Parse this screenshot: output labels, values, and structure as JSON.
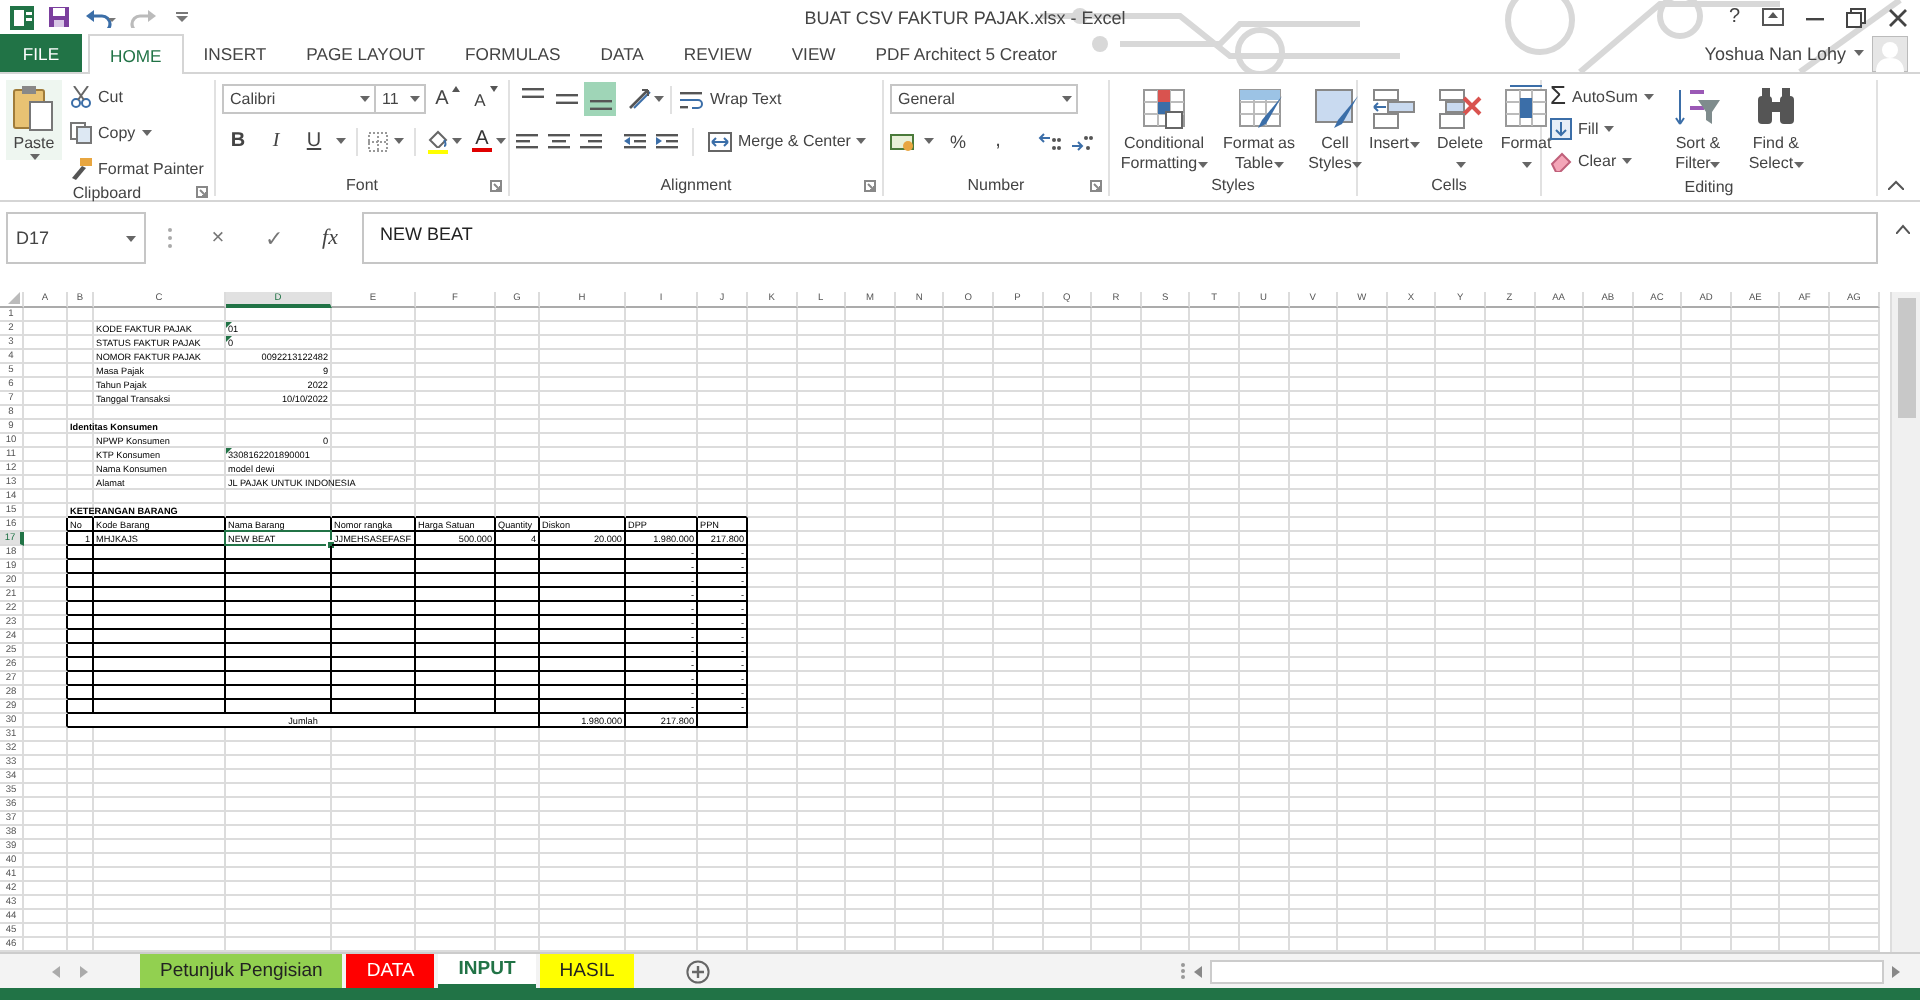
{
  "title_bar": {
    "title": "BUAT CSV FAKTUR PAJAK.xlsx - Excel",
    "help": "?"
  },
  "ribbon_tabs": [
    {
      "label": "FILE",
      "kind": "file",
      "selected": false
    },
    {
      "label": "HOME",
      "kind": "tab",
      "selected": true
    },
    {
      "label": "INSERT",
      "kind": "tab",
      "selected": false
    },
    {
      "label": "PAGE LAYOUT",
      "kind": "tab",
      "selected": false
    },
    {
      "label": "FORMULAS",
      "kind": "tab",
      "selected": false
    },
    {
      "label": "DATA",
      "kind": "tab",
      "selected": false
    },
    {
      "label": "REVIEW",
      "kind": "tab",
      "selected": false
    },
    {
      "label": "VIEW",
      "kind": "tab",
      "selected": false
    },
    {
      "label": "PDF Architect 5 Creator",
      "kind": "tab",
      "selected": false
    }
  ],
  "user": {
    "name": "Yoshua Nan Lohy"
  },
  "clipboard": {
    "paste": "Paste",
    "cut": "Cut",
    "copy": "Copy",
    "format_painter": "Format Painter",
    "label": "Clipboard"
  },
  "font": {
    "name": "Calibri",
    "size": "11",
    "grow": "A",
    "shrink": "A",
    "bold": "B",
    "italic": "I",
    "underline": "U",
    "color_button": "A",
    "label": "Font"
  },
  "alignment": {
    "vertical": [
      {
        "kind": "top",
        "selected": false
      },
      {
        "kind": "middle",
        "selected": false
      },
      {
        "kind": "bottom",
        "selected": true
      }
    ],
    "wrap_text": "Wrap Text",
    "merge": "Merge & Center",
    "label": "Alignment"
  },
  "number": {
    "format": "General",
    "percent": "%",
    "comma": ",",
    "label": "Number"
  },
  "styles": {
    "buttons": [
      "Conditional Formatting",
      "Format as Table",
      "Cell Styles"
    ],
    "label": "Styles"
  },
  "cells": {
    "buttons": [
      "Insert",
      "Delete",
      "Format"
    ],
    "label": "Cells"
  },
  "editing": {
    "sigma": "Σ",
    "autosum": "AutoSum",
    "fill": "Fill",
    "clear": "Clear",
    "sort": "Sort & Filter",
    "find": "Find & Select",
    "label": "Editing"
  },
  "formula_bar": {
    "name_box": "D17",
    "cancel": "×",
    "enter": "✓",
    "function": "fx",
    "value": "NEW BEAT"
  },
  "sheet": {
    "columns": [
      "A",
      "B",
      "C",
      "D",
      "E",
      "F",
      "G",
      "H",
      "I",
      "J",
      "K",
      "L",
      "M",
      "N",
      "O",
      "P",
      "Q",
      "R",
      "S",
      "T",
      "U",
      "V",
      "W",
      "X",
      "Y",
      "Z",
      "AA",
      "AB",
      "AC",
      "AD",
      "AE",
      "AF",
      "AG"
    ],
    "rows": [
      {
        "header": "1"
      },
      {
        "header": "2",
        "cells": {
          "C": {
            "text": "KODE FAKTUR PAJAK",
            "kind": "text",
            "selected": false,
            "warning": false
          },
          "D": {
            "text": "01",
            "kind": "text",
            "selected": false,
            "warning": true
          }
        }
      },
      {
        "header": "3",
        "cells": {
          "C": {
            "text": "STATUS FAKTUR PAJAK",
            "kind": "text",
            "selected": false,
            "warning": false
          },
          "D": {
            "text": "0",
            "kind": "text",
            "selected": false,
            "warning": true
          }
        }
      },
      {
        "header": "4",
        "cells": {
          "C": {
            "text": "NOMOR FAKTUR PAJAK",
            "kind": "text",
            "selected": false,
            "warning": false
          },
          "D": {
            "text": "0092213122482",
            "kind": "number",
            "selected": false,
            "warning": false
          }
        }
      },
      {
        "header": "5",
        "cells": {
          "C": {
            "text": "Masa Pajak",
            "kind": "text",
            "selected": false,
            "warning": false
          },
          "D": {
            "text": "9",
            "kind": "number",
            "selected": false,
            "warning": false
          }
        }
      },
      {
        "header": "6",
        "cells": {
          "C": {
            "text": "Tahun Pajak",
            "kind": "text",
            "selected": false,
            "warning": false
          },
          "D": {
            "text": "2022",
            "kind": "number",
            "selected": false,
            "warning": false
          }
        }
      },
      {
        "header": "7",
        "cells": {
          "C": {
            "text": "Tanggal Transaksi",
            "kind": "text",
            "selected": false,
            "warning": false
          },
          "D": {
            "text": "10/10/2022",
            "kind": "number",
            "selected": false,
            "warning": false
          }
        }
      },
      {
        "header": "8"
      },
      {
        "header": "9",
        "cells": {
          "B": {
            "text": "Identitas Konsumen",
            "kind": "heading",
            "selected": false,
            "warning": false
          }
        }
      },
      {
        "header": "10",
        "cells": {
          "C": {
            "text": "NPWP Konsumen",
            "kind": "text",
            "selected": false,
            "warning": false
          },
          "D": {
            "text": "0",
            "kind": "number",
            "selected": false,
            "warning": false
          }
        }
      },
      {
        "header": "11",
        "cells": {
          "C": {
            "text": "KTP Konsumen",
            "kind": "text",
            "selected": false,
            "warning": false
          },
          "D": {
            "text": "3308162201890001",
            "kind": "text",
            "selected": false,
            "warning": true
          }
        }
      },
      {
        "header": "12",
        "cells": {
          "C": {
            "text": "Nama Konsumen",
            "kind": "text",
            "selected": false,
            "warning": false
          },
          "D": {
            "text": "model dewi",
            "kind": "text",
            "selected": false,
            "warning": false
          }
        }
      },
      {
        "header": "13",
        "cells": {
          "C": {
            "text": "Alamat",
            "kind": "text",
            "selected": false,
            "warning": false
          },
          "D": {
            "text": "JL PAJAK UNTUK INDONESIA",
            "kind": "text",
            "selected": false,
            "warning": false
          }
        }
      },
      {
        "header": "14"
      },
      {
        "header": "15",
        "cells": {
          "B": {
            "text": "KETERANGAN BARANG",
            "kind": "heading",
            "selected": false,
            "warning": false
          }
        }
      },
      {
        "header": "16",
        "cells": {
          "B": {
            "text": "No",
            "kind": "text",
            "selected": false,
            "warning": false
          },
          "C": {
            "text": "Kode Barang",
            "kind": "text",
            "selected": false,
            "warning": false
          },
          "D": {
            "text": "Nama Barang",
            "kind": "text",
            "selected": false,
            "warning": false
          },
          "E": {
            "text": "Nomor rangka",
            "kind": "text",
            "selected": false,
            "warning": false
          },
          "F": {
            "text": "Harga Satuan",
            "kind": "text",
            "selected": false,
            "warning": false
          },
          "G": {
            "text": "Quantity",
            "kind": "text",
            "selected": false,
            "warning": false
          },
          "H": {
            "text": "Diskon",
            "kind": "text",
            "selected": false,
            "warning": false
          },
          "I": {
            "text": "DPP",
            "kind": "text",
            "selected": false,
            "warning": false
          },
          "J": {
            "text": "PPN",
            "kind": "text",
            "selected": false,
            "warning": false
          }
        }
      },
      {
        "header": "17",
        "cells": {
          "B": {
            "text": "1",
            "kind": "number",
            "selected": false,
            "warning": false
          },
          "C": {
            "text": "MHJKAJS",
            "kind": "text",
            "selected": false,
            "warning": false
          },
          "D": {
            "text": "NEW BEAT",
            "kind": "text",
            "selected": true,
            "warning": false
          },
          "E": {
            "text": "JJMEHSASEFASF",
            "kind": "text",
            "selected": false,
            "warning": false
          },
          "F": {
            "text": "500.000",
            "kind": "number",
            "selected": false,
            "warning": false
          },
          "G": {
            "text": "4",
            "kind": "number",
            "selected": false,
            "warning": false
          },
          "H": {
            "text": "20.000",
            "kind": "number",
            "selected": false,
            "warning": false
          },
          "I": {
            "text": "1.980.000",
            "kind": "number",
            "selected": false,
            "warning": false
          },
          "J": {
            "text": "217.800",
            "kind": "number",
            "selected": false,
            "warning": false
          }
        }
      },
      {
        "header": "18",
        "cells": {
          "I": {
            "text": "-",
            "kind": "number",
            "selected": false,
            "warning": false
          },
          "J": {
            "text": "-",
            "kind": "number",
            "selected": false,
            "warning": false
          }
        }
      },
      {
        "header": "19",
        "cells": {
          "I": {
            "text": "-",
            "kind": "number",
            "selected": false,
            "warning": false
          },
          "J": {
            "text": "-",
            "kind": "number",
            "selected": false,
            "warning": false
          }
        }
      },
      {
        "header": "20",
        "cells": {
          "I": {
            "text": "-",
            "kind": "number",
            "selected": false,
            "warning": false
          },
          "J": {
            "text": "-",
            "kind": "number",
            "selected": false,
            "warning": false
          }
        }
      },
      {
        "header": "21",
        "cells": {
          "I": {
            "text": "-",
            "kind": "number",
            "selected": false,
            "warning": false
          },
          "J": {
            "text": "-",
            "kind": "number",
            "selected": false,
            "warning": false
          }
        }
      },
      {
        "header": "22",
        "cells": {
          "I": {
            "text": "-",
            "kind": "number",
            "selected": false,
            "warning": false
          },
          "J": {
            "text": "-",
            "kind": "number",
            "selected": false,
            "warning": false
          }
        }
      },
      {
        "header": "23",
        "cells": {
          "I": {
            "text": "-",
            "kind": "number",
            "selected": false,
            "warning": false
          },
          "J": {
            "text": "-",
            "kind": "number",
            "selected": false,
            "warning": false
          }
        }
      },
      {
        "header": "24",
        "cells": {
          "I": {
            "text": "-",
            "kind": "number",
            "selected": false,
            "warning": false
          },
          "J": {
            "text": "-",
            "kind": "number",
            "selected": false,
            "warning": false
          }
        }
      },
      {
        "header": "25",
        "cells": {
          "I": {
            "text": "-",
            "kind": "number",
            "selected": false,
            "warning": false
          },
          "J": {
            "text": "-",
            "kind": "number",
            "selected": false,
            "warning": false
          }
        }
      },
      {
        "header": "26",
        "cells": {
          "I": {
            "text": "-",
            "kind": "number",
            "selected": false,
            "warning": false
          },
          "J": {
            "text": "-",
            "kind": "number",
            "selected": false,
            "warning": false
          }
        }
      },
      {
        "header": "27",
        "cells": {
          "I": {
            "text": "-",
            "kind": "number",
            "selected": false,
            "warning": false
          },
          "J": {
            "text": "-",
            "kind": "number",
            "selected": false,
            "warning": false
          }
        }
      },
      {
        "header": "28",
        "cells": {
          "I": {
            "text": "-",
            "kind": "number",
            "selected": false,
            "warning": false
          },
          "J": {
            "text": "-",
            "kind": "number",
            "selected": false,
            "warning": false
          }
        }
      },
      {
        "header": "29",
        "cells": {
          "I": {
            "text": "-",
            "kind": "number",
            "selected": false,
            "warning": false
          },
          "J": {
            "text": "-",
            "kind": "number",
            "selected": false,
            "warning": false
          }
        }
      },
      {
        "header": "30",
        "cells": {
          "B": {
            "text": "Jumlah",
            "kind": "total",
            "selected": false,
            "warning": false
          },
          "H": {
            "text": "1.980.000",
            "kind": "number",
            "selected": false,
            "warning": false
          },
          "I": {
            "text": "217.800",
            "kind": "number",
            "selected": false,
            "warning": false
          }
        }
      },
      {
        "header": "31"
      },
      {
        "header": "32"
      },
      {
        "header": "33"
      },
      {
        "header": "34"
      },
      {
        "header": "35"
      },
      {
        "header": "36"
      },
      {
        "header": "37"
      },
      {
        "header": "38"
      },
      {
        "header": "39"
      },
      {
        "header": "40"
      },
      {
        "header": "41"
      },
      {
        "header": "42"
      },
      {
        "header": "43"
      },
      {
        "header": "44"
      },
      {
        "header": "45"
      },
      {
        "header": "46"
      }
    ]
  },
  "sheet_tabs": [
    {
      "label": "Petunjuk Pengisian",
      "color": "#92d050",
      "selected": false
    },
    {
      "label": "DATA",
      "color": "#ff0000",
      "selected": false
    },
    {
      "label": "INPUT",
      "selected": true
    },
    {
      "label": "HASIL",
      "color": "#ffff00",
      "selected": false
    }
  ]
}
